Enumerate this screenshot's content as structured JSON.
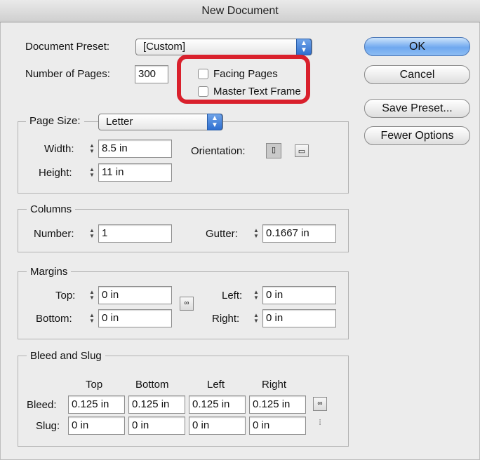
{
  "window": {
    "title": "New Document"
  },
  "preset": {
    "label": "Document Preset:",
    "value": "[Custom]"
  },
  "pages": {
    "label": "Number of Pages:",
    "value": "300",
    "facing_label": "Facing Pages",
    "master_label": "Master Text Frame"
  },
  "buttons": {
    "ok": "OK",
    "cancel": "Cancel",
    "save_preset": "Save Preset...",
    "fewer_options": "Fewer Options"
  },
  "page_size": {
    "label": "Page Size:",
    "value": "Letter",
    "width_label": "Width:",
    "width": "8.5 in",
    "height_label": "Height:",
    "height": "11 in",
    "orientation_label": "Orientation:"
  },
  "columns": {
    "legend": "Columns",
    "number_label": "Number:",
    "number": "1",
    "gutter_label": "Gutter:",
    "gutter": "0.1667 in"
  },
  "margins": {
    "legend": "Margins",
    "top_label": "Top:",
    "top": "0 in",
    "bottom_label": "Bottom:",
    "bottom": "0 in",
    "left_label": "Left:",
    "left": "0 in",
    "right_label": "Right:",
    "right": "0 in"
  },
  "bleed_slug": {
    "legend": "Bleed and Slug",
    "headers": [
      "Top",
      "Bottom",
      "Left",
      "Right"
    ],
    "bleed_label": "Bleed:",
    "bleed": [
      "0.125 in",
      "0.125 in",
      "0.125 in",
      "0.125 in"
    ],
    "slug_label": "Slug:",
    "slug": [
      "0 in",
      "0 in",
      "0 in",
      "0 in"
    ]
  },
  "colors": {
    "highlight": "#d9202c",
    "accent": "#2f6fd0"
  },
  "icons": {
    "stepper": "stepper-arrows-icon",
    "link": "chain-link-icon",
    "portrait": "portrait-orientation-icon",
    "landscape": "landscape-orientation-icon"
  }
}
